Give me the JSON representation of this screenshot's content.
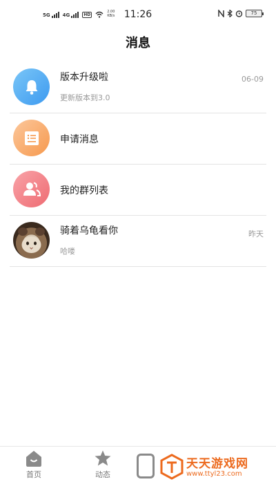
{
  "status_bar": {
    "net1": "5G",
    "net2": "4G",
    "hd": "HD",
    "speed_value": "2.00",
    "speed_unit": "KB/s",
    "time": "11:26",
    "battery": "75"
  },
  "header": {
    "title": "消息"
  },
  "messages": [
    {
      "name": "版本升级啦",
      "preview": "更新版本到3.0",
      "time": "06-09",
      "icon": "bell-icon"
    },
    {
      "name": "申请消息",
      "icon": "form-icon"
    },
    {
      "name": "我的群列表",
      "icon": "group-icon"
    },
    {
      "name": "骑着乌龟看你",
      "preview": "哈喽",
      "time": "昨天",
      "icon": "cat-avatar"
    }
  ],
  "tabs": [
    {
      "label": "首页",
      "icon": "home-icon"
    },
    {
      "label": "动态",
      "icon": "star-icon"
    }
  ],
  "watermark": {
    "title": "天天游戏网",
    "url": "www.ttyl23.com"
  },
  "colors": {
    "accent_blue": "#3d9af0",
    "accent_orange": "#f6994e",
    "accent_pink": "#ee6b72",
    "watermark_orange": "#ec6a1e"
  }
}
